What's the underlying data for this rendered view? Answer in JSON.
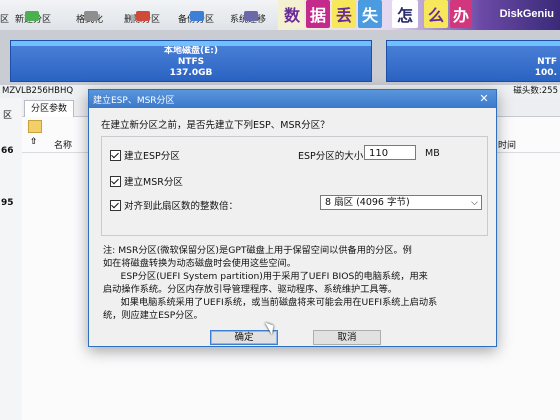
{
  "toolbar": {
    "items": [
      {
        "label": "新建分区"
      },
      {
        "label": "格式化"
      },
      {
        "label": "删除分区"
      },
      {
        "label": "备份分区"
      },
      {
        "label": "系统迁移"
      }
    ],
    "edge_fragment": "区"
  },
  "banner": {
    "tiles": [
      "数",
      "据",
      "丢",
      "失",
      "怎",
      "么",
      "办"
    ],
    "brand": "DiskGeniu"
  },
  "disk": {
    "partition_main": {
      "name": "本地磁盘(E:)",
      "fs": "NTFS",
      "size": "137.0GB"
    },
    "partition_right": {
      "fs": "NTF",
      "size": "100."
    }
  },
  "infoline": {
    "model": "MZVLB256HBHQ",
    "right": "磁头数:255"
  },
  "left_panel": {
    "markers": [
      "区",
      "66",
      "95"
    ]
  },
  "right_panel": {
    "tab": "分区参数",
    "name_header": "名称",
    "time_header": "时间"
  },
  "dialog": {
    "title": "建立ESP、MSR分区",
    "close_glyph": "✕",
    "question": "在建立新分区之前，是否先建立下列ESP、MSR分区？",
    "esp_checkbox": "建立ESP分区",
    "esp_size_label": "ESP分区的大小:",
    "esp_size_value": "110",
    "esp_size_unit": "MB",
    "msr_checkbox": "建立MSR分区",
    "align_checkbox": "对齐到此扇区数的整数倍：",
    "align_value": "8 扇区 (4096 字节)",
    "note_lines": [
      "注: MSR分区(微软保留分区)是GPT磁盘上用于保留空间以供备用的分区。例",
      "如在将磁盘转换为动态磁盘时会使用这些空间。",
      "      ESP分区(UEFI System partition)用于采用了UEFI BIOS的电脑系统，用来",
      "启动操作系统。分区内存放引导管理程序、驱动程序、系统维护工具等。",
      "      如果电脑系统采用了UEFI系统，或当前磁盘将来可能会用在UEFI系统上启动系",
      "统，则应建立ESP分区。"
    ],
    "ok_label": "确定",
    "cancel_label": "取消"
  },
  "colors": {
    "partition_blue": "#2b63c2",
    "title_blue": "#3b78c9",
    "brand_purple": "#3a2a78"
  }
}
